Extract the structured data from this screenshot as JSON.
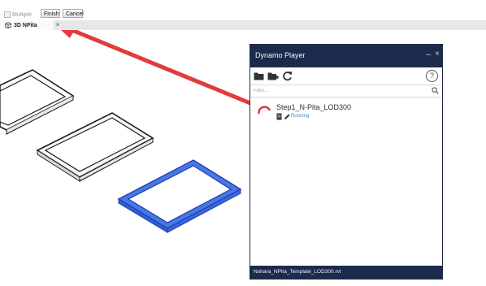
{
  "option_bar": {
    "multiple_label": "Multiple",
    "finish_label": "Finish",
    "cancel_label": "Cancel"
  },
  "view_tab": {
    "label": "3D NPita",
    "close": "×"
  },
  "dynamo_player": {
    "title": "Dynamo Player",
    "minimize": "–",
    "close": "×",
    "toolbar": {
      "icons": [
        "folder-icon",
        "folder-new-icon",
        "refresh-icon",
        "help-icon"
      ],
      "help_glyph": "?"
    },
    "filter": {
      "placeholder": "Filter..."
    },
    "scripts": [
      {
        "name": "Step1_N-Pita_LOD300",
        "status": "Running"
      }
    ],
    "footer": "Nohara_NPita_Template_LOD300.rvt"
  },
  "colors": {
    "panel_header": "#1c2b4b",
    "status_blue": "#3f86cf",
    "arrow_red": "#e23b3b",
    "selected_frame": "#2f5fd4",
    "spinner": "#e1352f"
  }
}
